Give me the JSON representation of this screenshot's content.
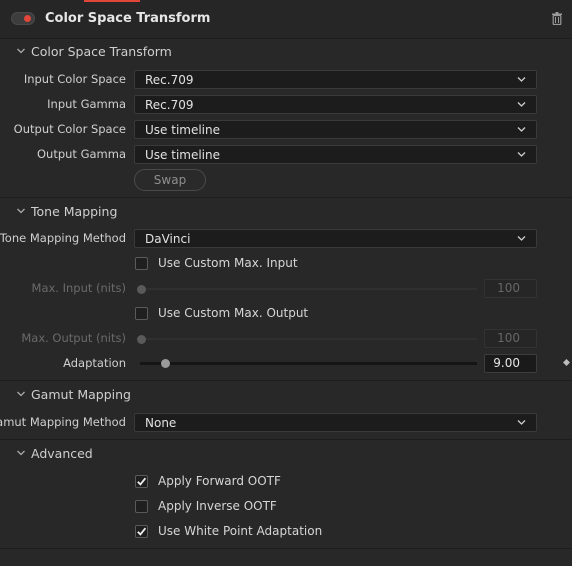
{
  "header": {
    "title": "Color Space Transform",
    "enabled": true,
    "accent_color": "#e0463a"
  },
  "sections": {
    "cst": {
      "label": "Color Space Transform",
      "input_color_space": {
        "label": "Input Color Space",
        "value": "Rec.709"
      },
      "input_gamma": {
        "label": "Input Gamma",
        "value": "Rec.709"
      },
      "output_color_space": {
        "label": "Output Color Space",
        "value": "Use timeline"
      },
      "output_gamma": {
        "label": "Output Gamma",
        "value": "Use timeline"
      },
      "swap_label": "Swap"
    },
    "tone": {
      "label": "Tone Mapping",
      "method": {
        "label": "Tone Mapping Method",
        "value": "DaVinci"
      },
      "custom_max_input": {
        "label": "Use Custom Max. Input",
        "checked": false
      },
      "max_input": {
        "label": "Max. Input (nits)",
        "value": "100"
      },
      "custom_max_output": {
        "label": "Use Custom Max. Output",
        "checked": false
      },
      "max_output": {
        "label": "Max. Output (nits)",
        "value": "100"
      },
      "adaptation": {
        "label": "Adaptation",
        "value": "9.00"
      }
    },
    "gamut": {
      "label": "Gamut Mapping",
      "method": {
        "label": "Gamut Mapping Method",
        "value": "None"
      }
    },
    "advanced": {
      "label": "Advanced",
      "apply_forward_ootf": {
        "label": "Apply Forward OOTF",
        "checked": true
      },
      "apply_inverse_ootf": {
        "label": "Apply Inverse OOTF",
        "checked": false
      },
      "white_point_adaptation": {
        "label": "Use White Point Adaptation",
        "checked": true
      }
    }
  },
  "icons": {
    "trash": "trash-icon",
    "chevron": "chevron-down-icon",
    "caret": "caret-down-icon",
    "check": "checkmark-icon",
    "keyframe": "keyframe-diamond-icon"
  }
}
